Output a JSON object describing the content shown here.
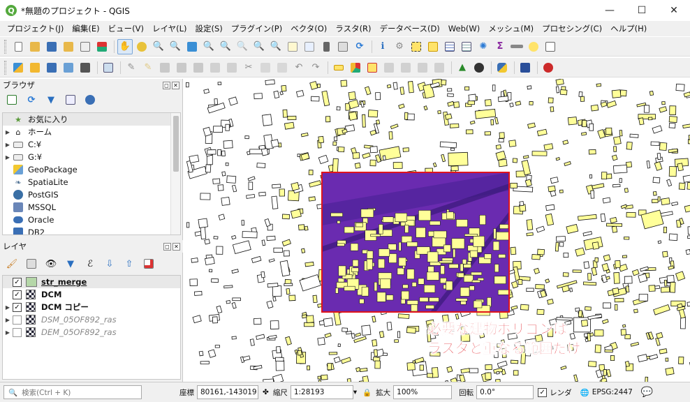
{
  "window": {
    "title": "*無題のプロジェクト - QGIS",
    "app_icon": "qgis-logo-icon",
    "minimize": "—",
    "maximize": "☐",
    "close": "✕"
  },
  "menu": [
    "プロジェクト(J)",
    "編集(E)",
    "ビュー(V)",
    "レイヤ(L)",
    "設定(S)",
    "プラグイン(P)",
    "ベクタ(O)",
    "ラスタ(R)",
    "データベース(D)",
    "Web(W)",
    "メッシュ(M)",
    "プロセシング(C)",
    "ヘルプ(H)"
  ],
  "browser_panel": {
    "title": "ブラウザ",
    "items": [
      {
        "label": "お気に入り",
        "icon": "star-icon",
        "expandable": false,
        "selected": true
      },
      {
        "label": "ホーム",
        "icon": "home-folder-icon",
        "expandable": true
      },
      {
        "label": "C:¥",
        "icon": "drive-icon",
        "expandable": true
      },
      {
        "label": "G:¥",
        "icon": "drive-icon",
        "expandable": true
      },
      {
        "label": "GeoPackage",
        "icon": "geopackage-icon",
        "expandable": false
      },
      {
        "label": "SpatiaLite",
        "icon": "spatialite-icon",
        "expandable": false
      },
      {
        "label": "PostGIS",
        "icon": "postgis-icon",
        "expandable": false
      },
      {
        "label": "MSSQL",
        "icon": "mssql-icon",
        "expandable": false
      },
      {
        "label": "Oracle",
        "icon": "oracle-icon",
        "expandable": false
      },
      {
        "label": "DB2",
        "icon": "db2-icon",
        "expandable": false
      }
    ]
  },
  "layers_panel": {
    "title": "レイヤ",
    "layers": [
      {
        "name": "str_merge",
        "checked": true,
        "type": "vector",
        "bold": true,
        "underline": true,
        "color": "#b5d7a8"
      },
      {
        "name": "DCM",
        "checked": true,
        "type": "raster",
        "bold": true
      },
      {
        "name": "DCM コピー",
        "checked": true,
        "type": "raster",
        "bold": true
      },
      {
        "name": "DSM_05OF892_ras",
        "checked": false,
        "type": "raster",
        "italic": true
      },
      {
        "name": "DEM_05OF892_ras",
        "checked": false,
        "type": "raster",
        "italic": true
      }
    ]
  },
  "map": {
    "callout_line1": "必要な建物ポリゴンは",
    "callout_line2": "ラスタと重なる範囲だけ",
    "colors": {
      "building": "#ffff99",
      "raster": "#6a2bb0",
      "highlight": "#e0141c"
    }
  },
  "status": {
    "search_placeholder": "検索(Ctrl + K)",
    "coord_label": "座標",
    "coord_value": "80161,-143019",
    "scale_label": "縮尺",
    "scale_value": "1:28193",
    "magnifier_label": "拡大",
    "magnifier_value": "100%",
    "rotation_label": "回転",
    "rotation_value": "0.0°",
    "render_label": "レンダ",
    "crs": "EPSG:2447"
  }
}
